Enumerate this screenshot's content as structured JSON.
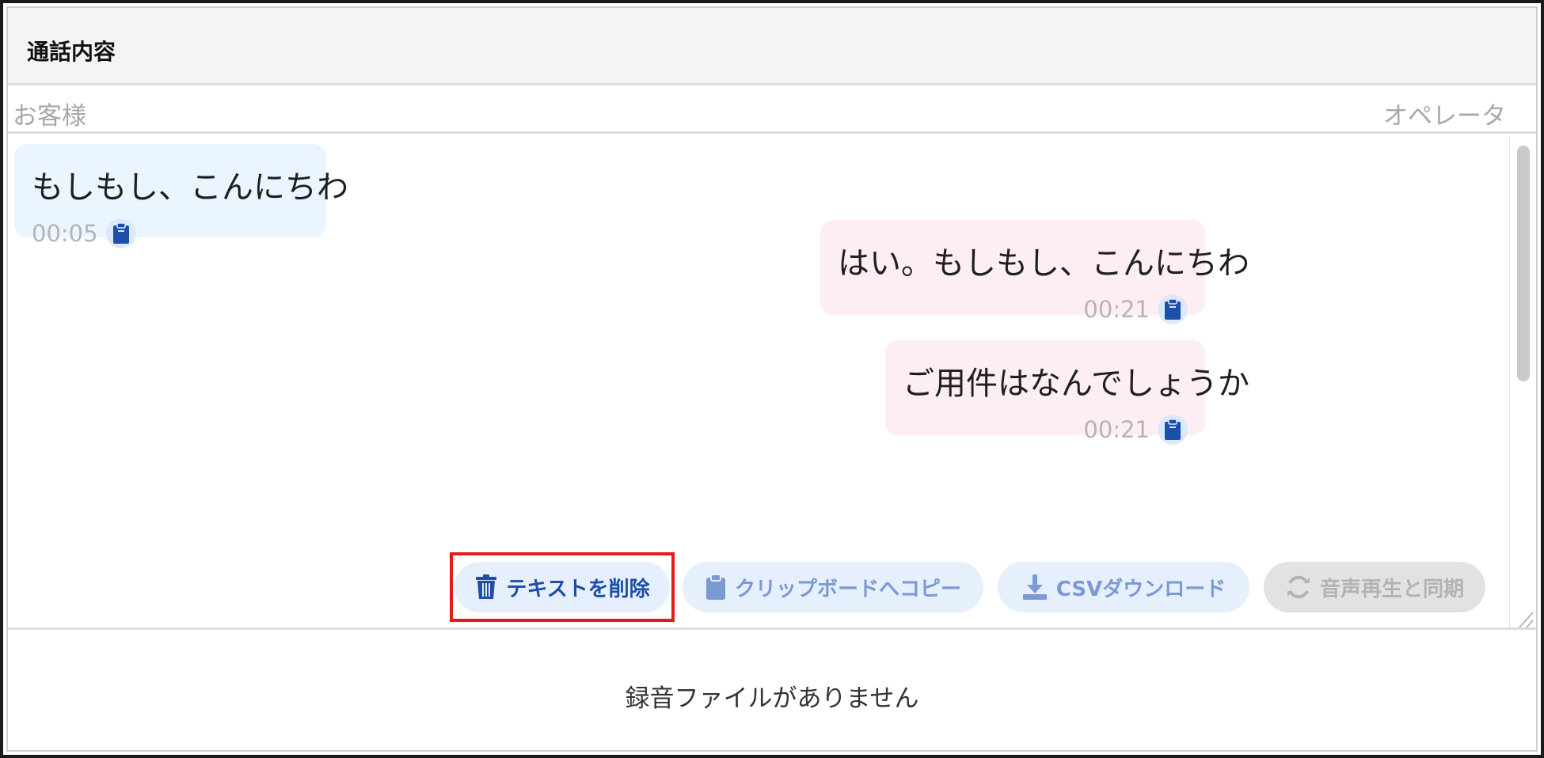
{
  "header": {
    "title": "通話内容"
  },
  "roles": {
    "customer": "お客様",
    "operator": "オペレータ"
  },
  "messages": [
    {
      "speaker": "customer",
      "text": "もしもし、こんにちわ",
      "time": "00:05"
    },
    {
      "speaker": "operator",
      "text": "はい。もしもし、こんにちわ",
      "time": "00:21"
    },
    {
      "speaker": "operator",
      "text": "ご用件はなんでしょうか",
      "time": "00:21"
    }
  ],
  "actions": {
    "delete_text": "テキストを削除",
    "copy_clipboard": "クリップボードへコピー",
    "csv_download": "CSVダウンロード",
    "sync_audio": "音声再生と同期"
  },
  "footer": {
    "message": "録音ファイルがありません"
  },
  "icons": {
    "clipboard": "clipboard-icon",
    "trash": "trash-icon",
    "download": "download-icon",
    "sync": "sync-icon"
  },
  "colors": {
    "primary": "#1c4fa8",
    "customer_bubble": "#eaf5ff",
    "operator_bubble": "#fdeef3",
    "highlight": "#e51b1b"
  }
}
